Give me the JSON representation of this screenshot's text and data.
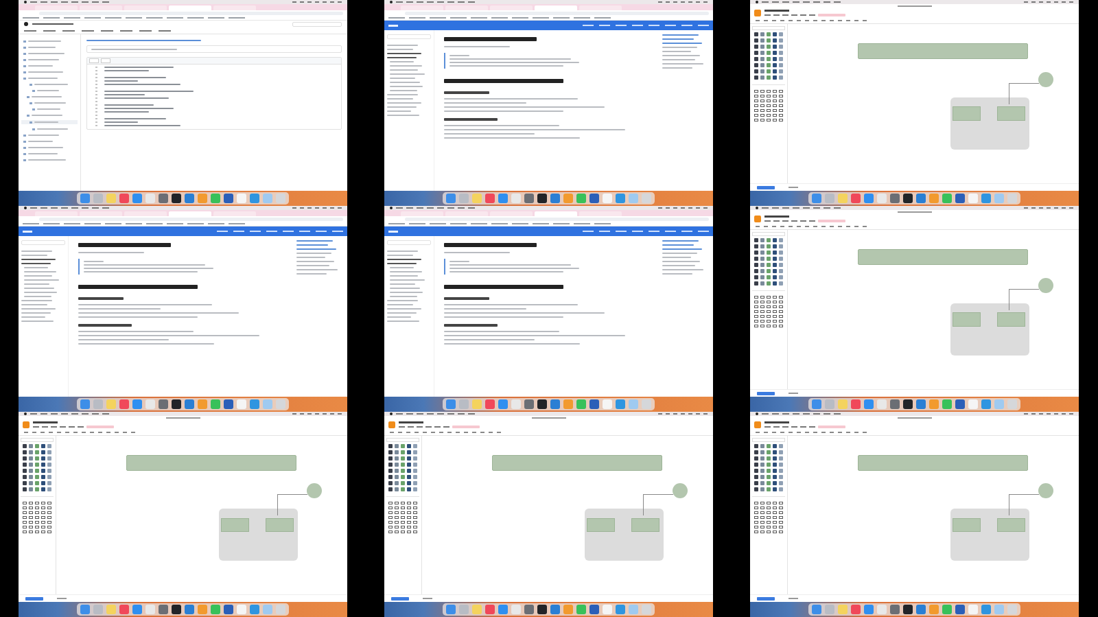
{
  "frames": [
    {
      "kind": "code-browser"
    },
    {
      "kind": "docs-page"
    },
    {
      "kind": "diagram-editor"
    },
    {
      "kind": "docs-page"
    },
    {
      "kind": "docs-page"
    },
    {
      "kind": "diagram-editor"
    },
    {
      "kind": "diagram-editor"
    },
    {
      "kind": "diagram-editor"
    },
    {
      "kind": "diagram-editor"
    }
  ]
}
